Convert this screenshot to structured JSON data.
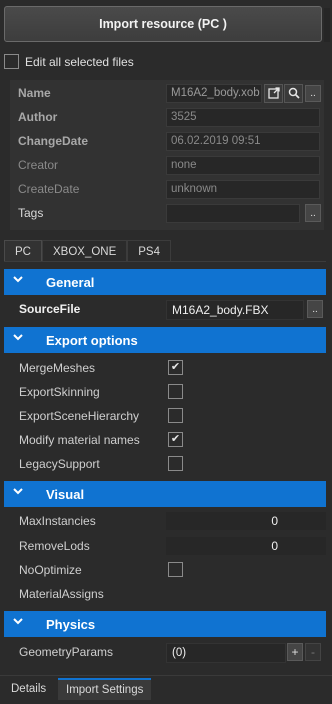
{
  "import_button": {
    "label": "Import resource (PC )"
  },
  "edit_all": {
    "label": "Edit all selected files",
    "checked": false
  },
  "meta": {
    "name": {
      "label": "Name",
      "value": "M16A2_body.xob"
    },
    "author": {
      "label": "Author",
      "value": "3525"
    },
    "change_date": {
      "label": "ChangeDate",
      "value": "06.02.2019 09:51"
    },
    "creator": {
      "label": "Creator",
      "value": "none"
    },
    "create_date": {
      "label": "CreateDate",
      "value": "unknown"
    },
    "tags": {
      "label": "Tags",
      "value": ""
    },
    "browse_label": ".."
  },
  "platform_tabs": [
    "PC",
    "XBOX_ONE",
    "PS4"
  ],
  "active_platform_tab": "PC",
  "sections": {
    "general": {
      "title": "General",
      "source_file": {
        "label": "SourceFile",
        "value": "M16A2_body.FBX"
      }
    },
    "export_options": {
      "title": "Export options",
      "items": [
        {
          "label": "MergeMeshes",
          "checked": true
        },
        {
          "label": "ExportSkinning",
          "checked": false
        },
        {
          "label": "ExportSceneHierarchy",
          "checked": false
        },
        {
          "label": "Modify material names",
          "checked": true
        },
        {
          "label": "LegacySupport",
          "checked": false
        }
      ]
    },
    "visual": {
      "title": "Visual",
      "max_instancies": {
        "label": "MaxInstancies",
        "value": "0"
      },
      "remove_lods": {
        "label": "RemoveLods",
        "value": "0"
      },
      "no_optimize": {
        "label": "NoOptimize",
        "checked": false
      },
      "material_assigns": {
        "label": "MaterialAssigns"
      }
    },
    "physics": {
      "title": "Physics",
      "geometry_params": {
        "label": "GeometryParams",
        "value": "(0)",
        "add": "+",
        "remove": "-"
      }
    }
  },
  "bottom_tabs": [
    "Details",
    "Import Settings"
  ],
  "active_bottom_tab": "Import Settings",
  "colors": {
    "accent": "#1073d1",
    "background": "#2b2b2b"
  }
}
